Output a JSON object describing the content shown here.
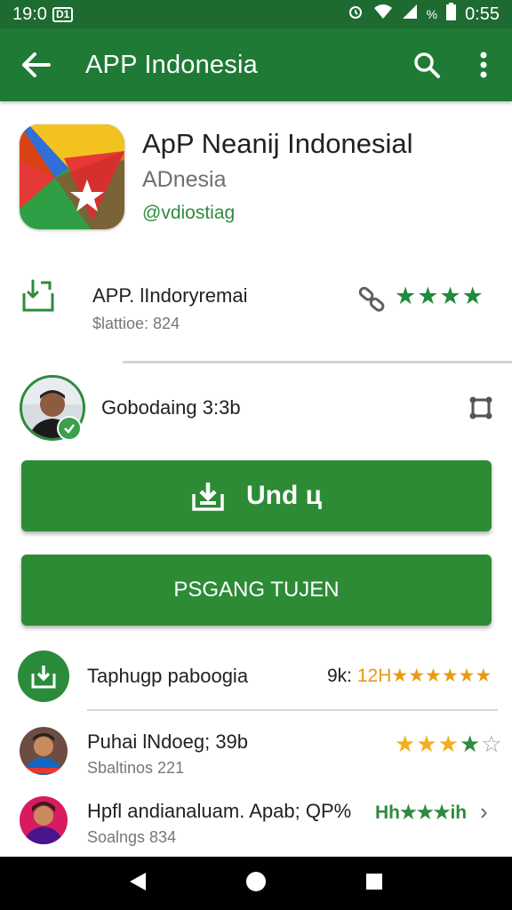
{
  "status_bar": {
    "time": "19:0",
    "badge": "D1",
    "right_time": "0:55",
    "percent": "%"
  },
  "appbar": {
    "title": "APP Indonesia"
  },
  "app": {
    "name": "ApP Neanij Indonesial",
    "developer": "ADnesia",
    "tag": "@vdiostiag"
  },
  "info": {
    "name": "APP. lIndorуremai",
    "sub": "$lattioe: 824",
    "stars": "★★★★"
  },
  "channel": {
    "label": "Gobodaing 3:3b"
  },
  "buttons": {
    "primary_label": "Und ц",
    "secondary_label": "PSGANG TUJEN"
  },
  "list": {
    "row1": {
      "label": "Taphugp paboogia",
      "meta_prefix": "9k:",
      "meta_rating": " 12H★★★★★★"
    },
    "row2": {
      "label": "Puhai lNdoeg; 39b",
      "sub": "Sbaltinos 221"
    },
    "row3": {
      "label": "Hpfl andianaluam. Apab; QP%",
      "sub": "Soalngs 834",
      "rating_text": "Hh★★★ih",
      "chevron": "›"
    }
  },
  "colors": {
    "appbar": "#1f7a35",
    "status_bar": "#1e6b32",
    "button": "#2d8b36",
    "star_green": "#1e8a3a",
    "star_gold": "#f2b01e"
  }
}
